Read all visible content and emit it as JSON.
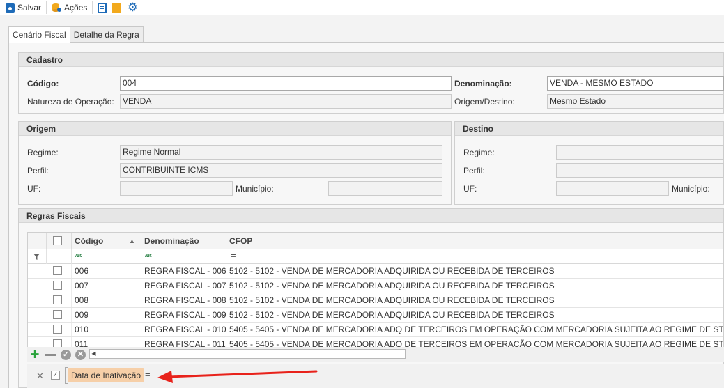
{
  "toolbar": {
    "save_label": "Salvar",
    "actions_label": "Ações"
  },
  "tabs": [
    {
      "label": "Cenário Fiscal"
    },
    {
      "label": "Detalhe da Regra"
    }
  ],
  "cadastro": {
    "title": "Cadastro",
    "codigo_label": "Código:",
    "codigo_value": "004",
    "denominacao_label": "Denominação:",
    "denominacao_value": "VENDA - MESMO ESTADO",
    "natureza_label": "Natureza de Operação:",
    "natureza_value": "VENDA",
    "origem_destino_label": "Origem/Destino:",
    "origem_destino_value": "Mesmo Estado"
  },
  "origem": {
    "title": "Origem",
    "regime_label": "Regime:",
    "regime_value": "Regime Normal",
    "perfil_label": "Perfil:",
    "perfil_value": "CONTRIBUINTE ICMS",
    "uf_label": "UF:",
    "uf_value": "",
    "municipio_label": "Município:",
    "municipio_value": ""
  },
  "destino": {
    "title": "Destino",
    "regime_label": "Regime:",
    "regime_value": "",
    "perfil_label": "Perfil:",
    "perfil_value": "",
    "uf_label": "UF:",
    "uf_value": "",
    "municipio_label": "Município:",
    "municipio_value": ""
  },
  "regras": {
    "title": "Regras Fiscais",
    "columns": {
      "codigo": "Código",
      "denominacao": "Denominação",
      "cfop": "CFOP"
    },
    "filter_abc": "ABC",
    "filter_eq": "=",
    "rows": [
      {
        "codigo": "006",
        "denominacao": "REGRA FISCAL - 006",
        "cfop": "5102 - 5102 - VENDA DE MERCADORIA ADQUIRIDA OU RECEBIDA DE TERCEIROS"
      },
      {
        "codigo": "007",
        "denominacao": "REGRA FISCAL - 007",
        "cfop": "5102 - 5102 - VENDA DE MERCADORIA ADQUIRIDA OU RECEBIDA DE TERCEIROS"
      },
      {
        "codigo": "008",
        "denominacao": "REGRA FISCAL - 008",
        "cfop": "5102 - 5102 - VENDA DE MERCADORIA ADQUIRIDA OU RECEBIDA DE TERCEIROS"
      },
      {
        "codigo": "009",
        "denominacao": "REGRA FISCAL - 009",
        "cfop": "5102 - 5102 - VENDA DE MERCADORIA ADQUIRIDA OU RECEBIDA DE TERCEIROS"
      },
      {
        "codigo": "010",
        "denominacao": "REGRA FISCAL - 010",
        "cfop": "5405 - 5405 - VENDA DE MERCADORIA ADQ DE TERCEIROS EM OPERAÇÃO COM MERCADORIA SUJEITA AO REGIME DE ST"
      },
      {
        "codigo": "011",
        "denominacao": "REGRA FISCAL - 011",
        "cfop": "5405 - 5405 - VENDA DE MERCADORIA ADQ DE TERCEIROS EM OPERAÇÃO COM MERCADORIA SUJEITA AO REGIME DE ST"
      }
    ]
  },
  "filter_bar": {
    "chip_label": "Data de Inativação",
    "eq_label": "="
  },
  "colors": {
    "accent": "#1e6bb8",
    "chip": "#f6cfa8",
    "arrow": "#e8221b",
    "add": "#2aa33c"
  }
}
